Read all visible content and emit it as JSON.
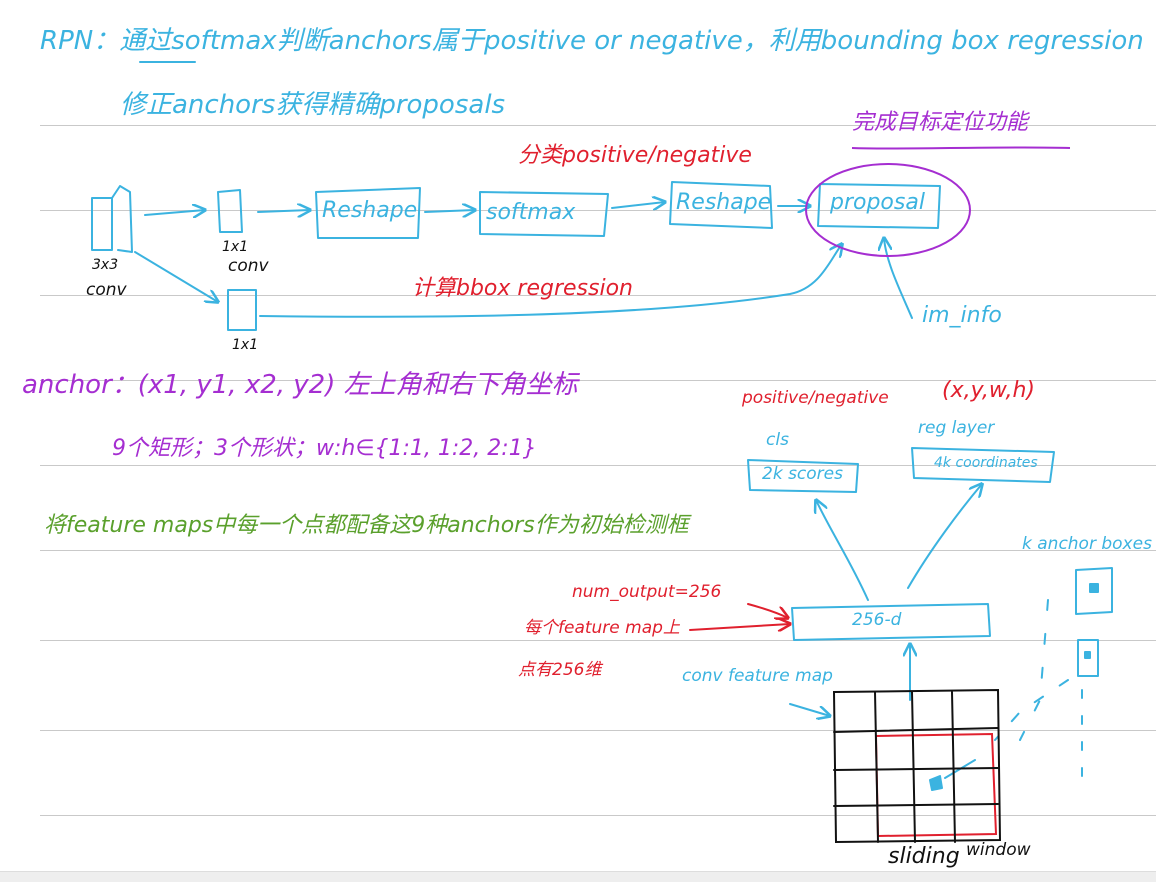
{
  "notes": {
    "line1": "RPN：通过softmax判断anchors属于positive or negative，利用bounding box regression",
    "line2": "修正anchors获得精确proposals",
    "func_note": "完成目标定位功能",
    "cls_note": "分类positive/negative",
    "bbox_note": "计算bbox regression",
    "anchor_def": "anchor：(x1, y1, x2, y2) 左上角和右下角坐标",
    "anchor_count": "9个矩形；3个形状；w:h∈{1:1, 1:2, 2:1}",
    "feature_note": "将feature maps中每一个点都配备这9种anchors作为初始检测框"
  },
  "flow_diagram": {
    "conv3x3_label": "3x3",
    "conv3x3_sub": "conv",
    "conv1x1_top_label": "1x1",
    "conv1x1_top_sub": "conv",
    "conv1x1_bottom_label": "1x1",
    "reshape1": "Reshape",
    "softmax": "softmax",
    "reshape2": "Reshape",
    "proposal": "proposal",
    "im_info": "im_info"
  },
  "rpn_diagram": {
    "pos_neg_label": "positive/negative",
    "xywh_label": "(x,y,w,h)",
    "cls_label": "cls",
    "reg_label": "reg layer",
    "cls_box": "2k scores",
    "reg_box": "4k coordinates",
    "feature_box": "256-d",
    "num_output": "num_output=256",
    "per_point_line1": "每个feature map上",
    "per_point_line2": "点有256维",
    "conv_feature_map": "conv feature map",
    "k_anchor_boxes": "k anchor boxes",
    "sliding": "sliding",
    "window": "window"
  },
  "colors": {
    "blue": "#3bb3e0",
    "purple": "#a52ed1",
    "red": "#e0202e",
    "green": "#5aa02c",
    "black": "#111111"
  }
}
